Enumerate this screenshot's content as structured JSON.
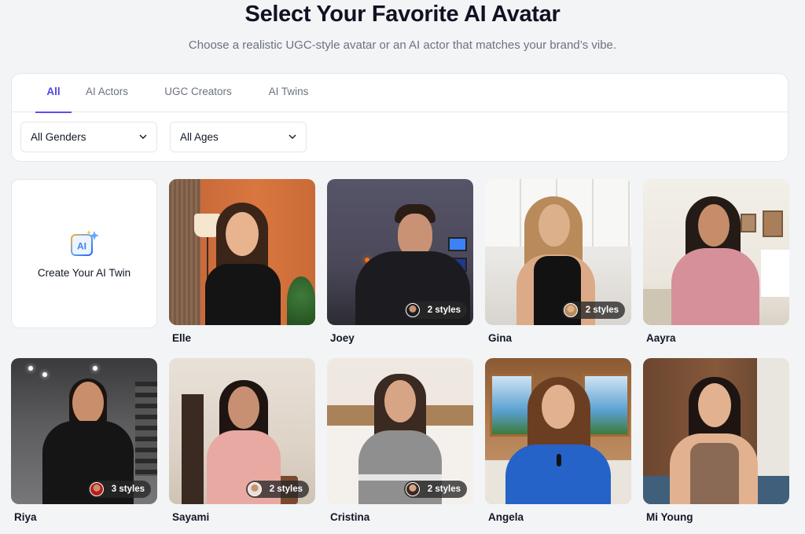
{
  "header": {
    "title": "Select Your Favorite AI Avatar",
    "subtitle": "Choose a realistic UGC-style avatar or an AI actor that matches your brand’s vibe."
  },
  "tabs": [
    {
      "label": "All",
      "active": true
    },
    {
      "label": "AI Actors",
      "active": false
    },
    {
      "label": "UGC Creators",
      "active": false
    },
    {
      "label": "AI Twins",
      "active": false
    }
  ],
  "filters": {
    "gender": {
      "selected": "All Genders"
    },
    "age": {
      "selected": "All Ages"
    }
  },
  "create_card": {
    "label": "Create Your AI Twin",
    "icon_text": "AI",
    "icon": "ai-sparkle-icon"
  },
  "avatars": [
    {
      "name": "Elle",
      "styles": ""
    },
    {
      "name": "Joey",
      "styles": "2 styles"
    },
    {
      "name": "Gina",
      "styles": "2 styles"
    },
    {
      "name": "Aayra",
      "styles": ""
    },
    {
      "name": "Riya",
      "styles": "3 styles"
    },
    {
      "name": "Sayami",
      "styles": "2 styles"
    },
    {
      "name": "Cristina",
      "styles": "2 styles"
    },
    {
      "name": "Angela",
      "styles": ""
    },
    {
      "name": "Mi Young",
      "styles": ""
    }
  ],
  "colors": {
    "accent": "#4f46e5",
    "background": "#f3f4f6",
    "card": "#ffffff",
    "muted_text": "#6b7280"
  }
}
